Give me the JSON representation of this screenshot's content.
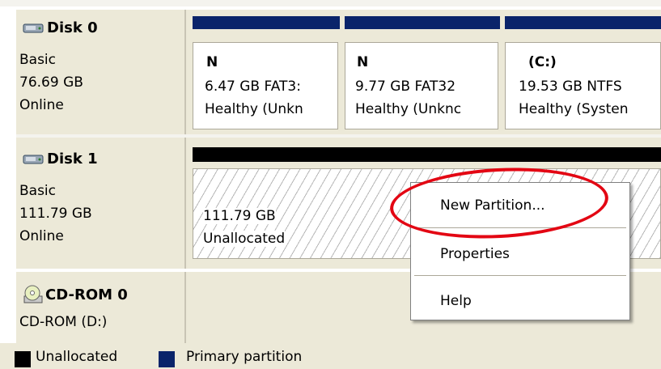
{
  "disks": [
    {
      "name": "Disk 0",
      "type": "Basic",
      "size": "76.69 GB",
      "status": "Online",
      "icon": "disk-icon",
      "partitions": [
        {
          "name": "N",
          "detail": "6.47 GB FAT3:",
          "state": "Healthy (Unkn"
        },
        {
          "name": "N",
          "detail": "9.77 GB FAT32",
          "state": "Healthy (Unknc"
        },
        {
          "name": "(C:)",
          "detail": "19.53 GB NTFS",
          "state": "Healthy (Systen"
        }
      ]
    },
    {
      "name": "Disk 1",
      "type": "Basic",
      "size": "111.79 GB",
      "status": "Online",
      "icon": "disk-icon",
      "unallocated": {
        "size": "111.79 GB",
        "label": "Unallocated"
      }
    },
    {
      "name": "CD-ROM 0",
      "type": "CD-ROM (D:)",
      "icon": "cdrom-icon"
    }
  ],
  "context_menu": {
    "items": [
      "New Partition...",
      "Properties",
      "Help"
    ],
    "highlighted": "New Partition..."
  },
  "legend": [
    {
      "label": "Unallocated",
      "color": "#000000"
    },
    {
      "label": "Primary partition",
      "color": "#0a246a"
    }
  ],
  "colors": {
    "primary_partition": "#0a246a",
    "unallocated": "#000000",
    "annotation": "#e30613"
  }
}
